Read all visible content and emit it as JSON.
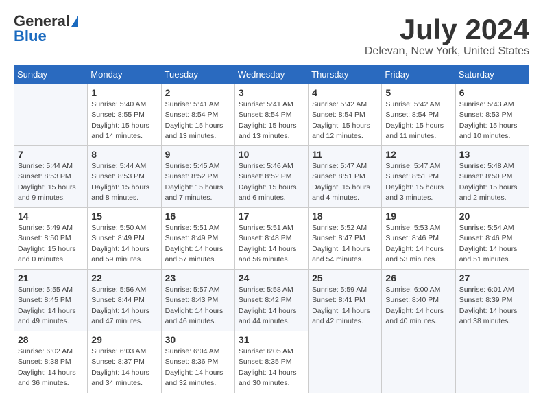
{
  "header": {
    "logo_general": "General",
    "logo_blue": "Blue",
    "month_title": "July 2024",
    "location": "Delevan, New York, United States"
  },
  "calendar": {
    "days_of_week": [
      "Sunday",
      "Monday",
      "Tuesday",
      "Wednesday",
      "Thursday",
      "Friday",
      "Saturday"
    ],
    "weeks": [
      [
        {
          "day": "",
          "info": ""
        },
        {
          "day": "1",
          "info": "Sunrise: 5:40 AM\nSunset: 8:55 PM\nDaylight: 15 hours\nand 14 minutes."
        },
        {
          "day": "2",
          "info": "Sunrise: 5:41 AM\nSunset: 8:54 PM\nDaylight: 15 hours\nand 13 minutes."
        },
        {
          "day": "3",
          "info": "Sunrise: 5:41 AM\nSunset: 8:54 PM\nDaylight: 15 hours\nand 13 minutes."
        },
        {
          "day": "4",
          "info": "Sunrise: 5:42 AM\nSunset: 8:54 PM\nDaylight: 15 hours\nand 12 minutes."
        },
        {
          "day": "5",
          "info": "Sunrise: 5:42 AM\nSunset: 8:54 PM\nDaylight: 15 hours\nand 11 minutes."
        },
        {
          "day": "6",
          "info": "Sunrise: 5:43 AM\nSunset: 8:53 PM\nDaylight: 15 hours\nand 10 minutes."
        }
      ],
      [
        {
          "day": "7",
          "info": "Sunrise: 5:44 AM\nSunset: 8:53 PM\nDaylight: 15 hours\nand 9 minutes."
        },
        {
          "day": "8",
          "info": "Sunrise: 5:44 AM\nSunset: 8:53 PM\nDaylight: 15 hours\nand 8 minutes."
        },
        {
          "day": "9",
          "info": "Sunrise: 5:45 AM\nSunset: 8:52 PM\nDaylight: 15 hours\nand 7 minutes."
        },
        {
          "day": "10",
          "info": "Sunrise: 5:46 AM\nSunset: 8:52 PM\nDaylight: 15 hours\nand 6 minutes."
        },
        {
          "day": "11",
          "info": "Sunrise: 5:47 AM\nSunset: 8:51 PM\nDaylight: 15 hours\nand 4 minutes."
        },
        {
          "day": "12",
          "info": "Sunrise: 5:47 AM\nSunset: 8:51 PM\nDaylight: 15 hours\nand 3 minutes."
        },
        {
          "day": "13",
          "info": "Sunrise: 5:48 AM\nSunset: 8:50 PM\nDaylight: 15 hours\nand 2 minutes."
        }
      ],
      [
        {
          "day": "14",
          "info": "Sunrise: 5:49 AM\nSunset: 8:50 PM\nDaylight: 15 hours\nand 0 minutes."
        },
        {
          "day": "15",
          "info": "Sunrise: 5:50 AM\nSunset: 8:49 PM\nDaylight: 14 hours\nand 59 minutes."
        },
        {
          "day": "16",
          "info": "Sunrise: 5:51 AM\nSunset: 8:49 PM\nDaylight: 14 hours\nand 57 minutes."
        },
        {
          "day": "17",
          "info": "Sunrise: 5:51 AM\nSunset: 8:48 PM\nDaylight: 14 hours\nand 56 minutes."
        },
        {
          "day": "18",
          "info": "Sunrise: 5:52 AM\nSunset: 8:47 PM\nDaylight: 14 hours\nand 54 minutes."
        },
        {
          "day": "19",
          "info": "Sunrise: 5:53 AM\nSunset: 8:46 PM\nDaylight: 14 hours\nand 53 minutes."
        },
        {
          "day": "20",
          "info": "Sunrise: 5:54 AM\nSunset: 8:46 PM\nDaylight: 14 hours\nand 51 minutes."
        }
      ],
      [
        {
          "day": "21",
          "info": "Sunrise: 5:55 AM\nSunset: 8:45 PM\nDaylight: 14 hours\nand 49 minutes."
        },
        {
          "day": "22",
          "info": "Sunrise: 5:56 AM\nSunset: 8:44 PM\nDaylight: 14 hours\nand 47 minutes."
        },
        {
          "day": "23",
          "info": "Sunrise: 5:57 AM\nSunset: 8:43 PM\nDaylight: 14 hours\nand 46 minutes."
        },
        {
          "day": "24",
          "info": "Sunrise: 5:58 AM\nSunset: 8:42 PM\nDaylight: 14 hours\nand 44 minutes."
        },
        {
          "day": "25",
          "info": "Sunrise: 5:59 AM\nSunset: 8:41 PM\nDaylight: 14 hours\nand 42 minutes."
        },
        {
          "day": "26",
          "info": "Sunrise: 6:00 AM\nSunset: 8:40 PM\nDaylight: 14 hours\nand 40 minutes."
        },
        {
          "day": "27",
          "info": "Sunrise: 6:01 AM\nSunset: 8:39 PM\nDaylight: 14 hours\nand 38 minutes."
        }
      ],
      [
        {
          "day": "28",
          "info": "Sunrise: 6:02 AM\nSunset: 8:38 PM\nDaylight: 14 hours\nand 36 minutes."
        },
        {
          "day": "29",
          "info": "Sunrise: 6:03 AM\nSunset: 8:37 PM\nDaylight: 14 hours\nand 34 minutes."
        },
        {
          "day": "30",
          "info": "Sunrise: 6:04 AM\nSunset: 8:36 PM\nDaylight: 14 hours\nand 32 minutes."
        },
        {
          "day": "31",
          "info": "Sunrise: 6:05 AM\nSunset: 8:35 PM\nDaylight: 14 hours\nand 30 minutes."
        },
        {
          "day": "",
          "info": ""
        },
        {
          "day": "",
          "info": ""
        },
        {
          "day": "",
          "info": ""
        }
      ]
    ]
  }
}
